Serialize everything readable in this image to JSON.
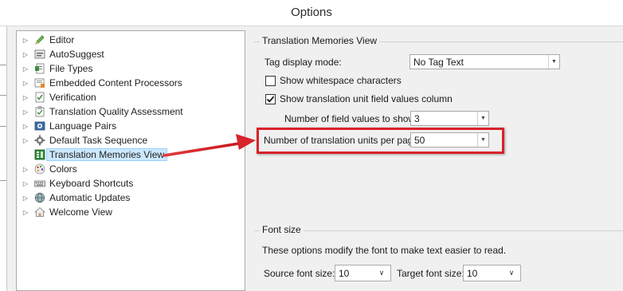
{
  "window": {
    "title": "Options"
  },
  "tree": {
    "items": [
      {
        "label": "Editor",
        "icon": "pencil-icon",
        "expandable": true
      },
      {
        "label": "AutoSuggest",
        "icon": "autosuggest-icon",
        "expandable": true
      },
      {
        "label": "File Types",
        "icon": "file-types-icon",
        "expandable": true
      },
      {
        "label": "Embedded Content Processors",
        "icon": "embedded-content-icon",
        "expandable": true
      },
      {
        "label": "Verification",
        "icon": "verification-icon",
        "expandable": true
      },
      {
        "label": "Translation Quality Assessment",
        "icon": "quality-assessment-icon",
        "expandable": true
      },
      {
        "label": "Language Pairs",
        "icon": "language-pairs-icon",
        "expandable": true
      },
      {
        "label": "Default Task Sequence",
        "icon": "gear-icon",
        "expandable": true
      },
      {
        "label": "Translation Memories View",
        "icon": "translation-memory-icon",
        "expandable": false,
        "selected": true
      },
      {
        "label": "Colors",
        "icon": "palette-icon",
        "expandable": true
      },
      {
        "label": "Keyboard Shortcuts",
        "icon": "keyboard-icon",
        "expandable": true
      },
      {
        "label": "Automatic Updates",
        "icon": "globe-icon",
        "expandable": true
      },
      {
        "label": "Welcome View",
        "icon": "home-icon",
        "expandable": true
      }
    ]
  },
  "tm_view": {
    "group_title": "Translation Memories View",
    "tag_display_mode": {
      "label": "Tag display mode:",
      "value": "No Tag Text"
    },
    "show_whitespace": {
      "label": "Show whitespace characters",
      "checked": false
    },
    "show_field_values": {
      "label": "Show translation unit field values column",
      "checked": true
    },
    "field_values_count": {
      "label": "Number of field values to show:",
      "value": "3"
    },
    "units_per_page": {
      "label": "Number of translation units per page:",
      "value": "50"
    }
  },
  "font_size": {
    "group_title": "Font size",
    "description": "These options modify the font to make text easier to read.",
    "source": {
      "label": "Source font size:",
      "value": "10"
    },
    "target": {
      "label": "Target font size:",
      "value": "10"
    }
  },
  "colors": {
    "selection_bg": "#cce8ff",
    "annotation_red": "#d8232a",
    "window_bg": "#f0f0f0"
  }
}
